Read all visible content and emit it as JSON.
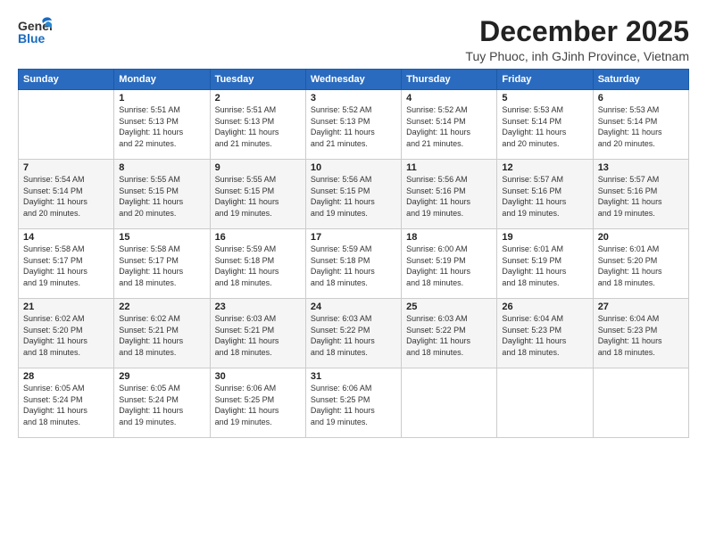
{
  "logo": {
    "general": "General",
    "blue": "Blue"
  },
  "title": "December 2025",
  "subtitle": "Tuy Phuoc, inh GJinh Province, Vietnam",
  "days_header": [
    "Sunday",
    "Monday",
    "Tuesday",
    "Wednesday",
    "Thursday",
    "Friday",
    "Saturday"
  ],
  "weeks": [
    [
      {
        "num": "",
        "info": ""
      },
      {
        "num": "1",
        "info": "Sunrise: 5:51 AM\nSunset: 5:13 PM\nDaylight: 11 hours\nand 22 minutes."
      },
      {
        "num": "2",
        "info": "Sunrise: 5:51 AM\nSunset: 5:13 PM\nDaylight: 11 hours\nand 21 minutes."
      },
      {
        "num": "3",
        "info": "Sunrise: 5:52 AM\nSunset: 5:13 PM\nDaylight: 11 hours\nand 21 minutes."
      },
      {
        "num": "4",
        "info": "Sunrise: 5:52 AM\nSunset: 5:14 PM\nDaylight: 11 hours\nand 21 minutes."
      },
      {
        "num": "5",
        "info": "Sunrise: 5:53 AM\nSunset: 5:14 PM\nDaylight: 11 hours\nand 20 minutes."
      },
      {
        "num": "6",
        "info": "Sunrise: 5:53 AM\nSunset: 5:14 PM\nDaylight: 11 hours\nand 20 minutes."
      }
    ],
    [
      {
        "num": "7",
        "info": "Sunrise: 5:54 AM\nSunset: 5:14 PM\nDaylight: 11 hours\nand 20 minutes."
      },
      {
        "num": "8",
        "info": "Sunrise: 5:55 AM\nSunset: 5:15 PM\nDaylight: 11 hours\nand 20 minutes."
      },
      {
        "num": "9",
        "info": "Sunrise: 5:55 AM\nSunset: 5:15 PM\nDaylight: 11 hours\nand 19 minutes."
      },
      {
        "num": "10",
        "info": "Sunrise: 5:56 AM\nSunset: 5:15 PM\nDaylight: 11 hours\nand 19 minutes."
      },
      {
        "num": "11",
        "info": "Sunrise: 5:56 AM\nSunset: 5:16 PM\nDaylight: 11 hours\nand 19 minutes."
      },
      {
        "num": "12",
        "info": "Sunrise: 5:57 AM\nSunset: 5:16 PM\nDaylight: 11 hours\nand 19 minutes."
      },
      {
        "num": "13",
        "info": "Sunrise: 5:57 AM\nSunset: 5:16 PM\nDaylight: 11 hours\nand 19 minutes."
      }
    ],
    [
      {
        "num": "14",
        "info": "Sunrise: 5:58 AM\nSunset: 5:17 PM\nDaylight: 11 hours\nand 19 minutes."
      },
      {
        "num": "15",
        "info": "Sunrise: 5:58 AM\nSunset: 5:17 PM\nDaylight: 11 hours\nand 18 minutes."
      },
      {
        "num": "16",
        "info": "Sunrise: 5:59 AM\nSunset: 5:18 PM\nDaylight: 11 hours\nand 18 minutes."
      },
      {
        "num": "17",
        "info": "Sunrise: 5:59 AM\nSunset: 5:18 PM\nDaylight: 11 hours\nand 18 minutes."
      },
      {
        "num": "18",
        "info": "Sunrise: 6:00 AM\nSunset: 5:19 PM\nDaylight: 11 hours\nand 18 minutes."
      },
      {
        "num": "19",
        "info": "Sunrise: 6:01 AM\nSunset: 5:19 PM\nDaylight: 11 hours\nand 18 minutes."
      },
      {
        "num": "20",
        "info": "Sunrise: 6:01 AM\nSunset: 5:20 PM\nDaylight: 11 hours\nand 18 minutes."
      }
    ],
    [
      {
        "num": "21",
        "info": "Sunrise: 6:02 AM\nSunset: 5:20 PM\nDaylight: 11 hours\nand 18 minutes."
      },
      {
        "num": "22",
        "info": "Sunrise: 6:02 AM\nSunset: 5:21 PM\nDaylight: 11 hours\nand 18 minutes."
      },
      {
        "num": "23",
        "info": "Sunrise: 6:03 AM\nSunset: 5:21 PM\nDaylight: 11 hours\nand 18 minutes."
      },
      {
        "num": "24",
        "info": "Sunrise: 6:03 AM\nSunset: 5:22 PM\nDaylight: 11 hours\nand 18 minutes."
      },
      {
        "num": "25",
        "info": "Sunrise: 6:03 AM\nSunset: 5:22 PM\nDaylight: 11 hours\nand 18 minutes."
      },
      {
        "num": "26",
        "info": "Sunrise: 6:04 AM\nSunset: 5:23 PM\nDaylight: 11 hours\nand 18 minutes."
      },
      {
        "num": "27",
        "info": "Sunrise: 6:04 AM\nSunset: 5:23 PM\nDaylight: 11 hours\nand 18 minutes."
      }
    ],
    [
      {
        "num": "28",
        "info": "Sunrise: 6:05 AM\nSunset: 5:24 PM\nDaylight: 11 hours\nand 18 minutes."
      },
      {
        "num": "29",
        "info": "Sunrise: 6:05 AM\nSunset: 5:24 PM\nDaylight: 11 hours\nand 19 minutes."
      },
      {
        "num": "30",
        "info": "Sunrise: 6:06 AM\nSunset: 5:25 PM\nDaylight: 11 hours\nand 19 minutes."
      },
      {
        "num": "31",
        "info": "Sunrise: 6:06 AM\nSunset: 5:25 PM\nDaylight: 11 hours\nand 19 minutes."
      },
      {
        "num": "",
        "info": ""
      },
      {
        "num": "",
        "info": ""
      },
      {
        "num": "",
        "info": ""
      }
    ]
  ]
}
